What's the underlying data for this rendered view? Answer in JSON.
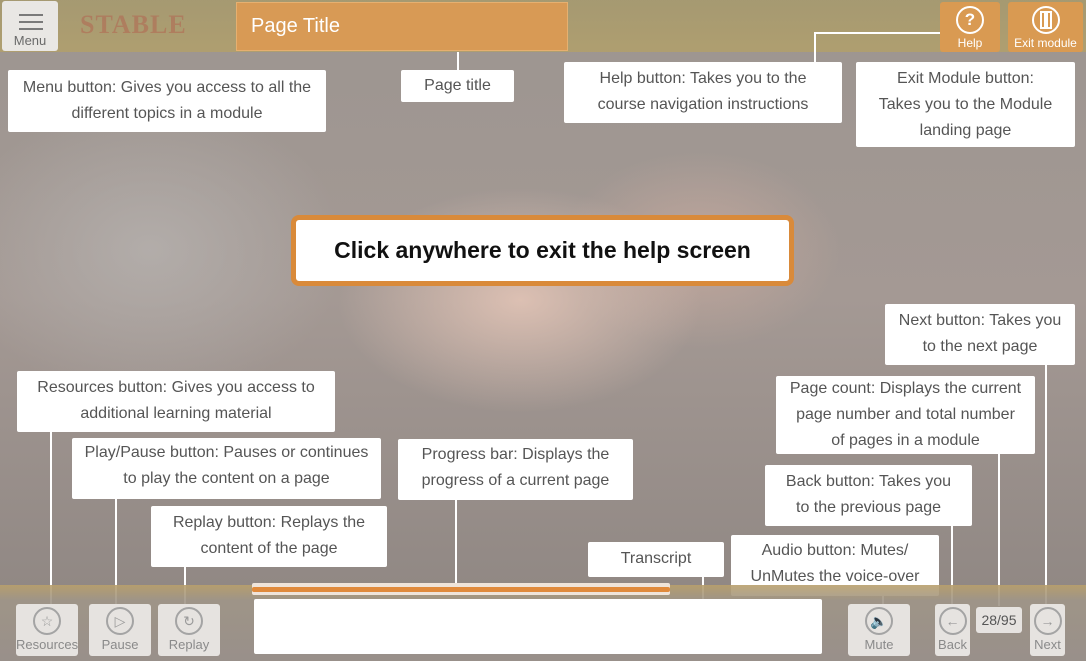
{
  "header": {
    "menu_label": "Menu",
    "page_title": "Page Title",
    "help_label": "Help",
    "exit_label": "Exit module",
    "logo_text": "STABLE"
  },
  "center_message": "Click anywhere to exit the help screen",
  "tips": {
    "menu": [
      "Menu button: Gives you access to all the",
      "different topics in a module"
    ],
    "page_title": [
      "Page title"
    ],
    "help": [
      "Help button: Takes you to the",
      "course navigation instructions"
    ],
    "exit": [
      "Exit Module button:",
      "Takes you to the Module",
      "landing page"
    ],
    "next": [
      "Next button: Takes you",
      "to the next page"
    ],
    "page_count": [
      "Page count: Displays the current",
      "page number and total number",
      "of pages in a module"
    ],
    "back": [
      "Back button: Takes you",
      "to the previous page"
    ],
    "audio": [
      "Audio button: Mutes/",
      "UnMutes the voice-over"
    ],
    "transcript": [
      "Transcript"
    ],
    "progress": [
      "Progress bar: Displays the",
      "progress of a current page"
    ],
    "resources": [
      "Resources button: Gives you access to",
      "additional learning material"
    ],
    "play_pause": [
      "Play/Pause button: Pauses or continues",
      "to play the content on a page"
    ],
    "replay": [
      "Replay button: Replays the",
      "content of the page"
    ]
  },
  "footer": {
    "resources_label": "Resources",
    "pause_label": "Pause",
    "replay_label": "Replay",
    "mute_label": "Mute",
    "back_label": "Back",
    "next_label": "Next",
    "page_count": "28/95",
    "progress": 1.0
  },
  "colors": {
    "accent": "#d99a52",
    "progress": "#e08a3c",
    "center_border": "#d98a3a"
  }
}
